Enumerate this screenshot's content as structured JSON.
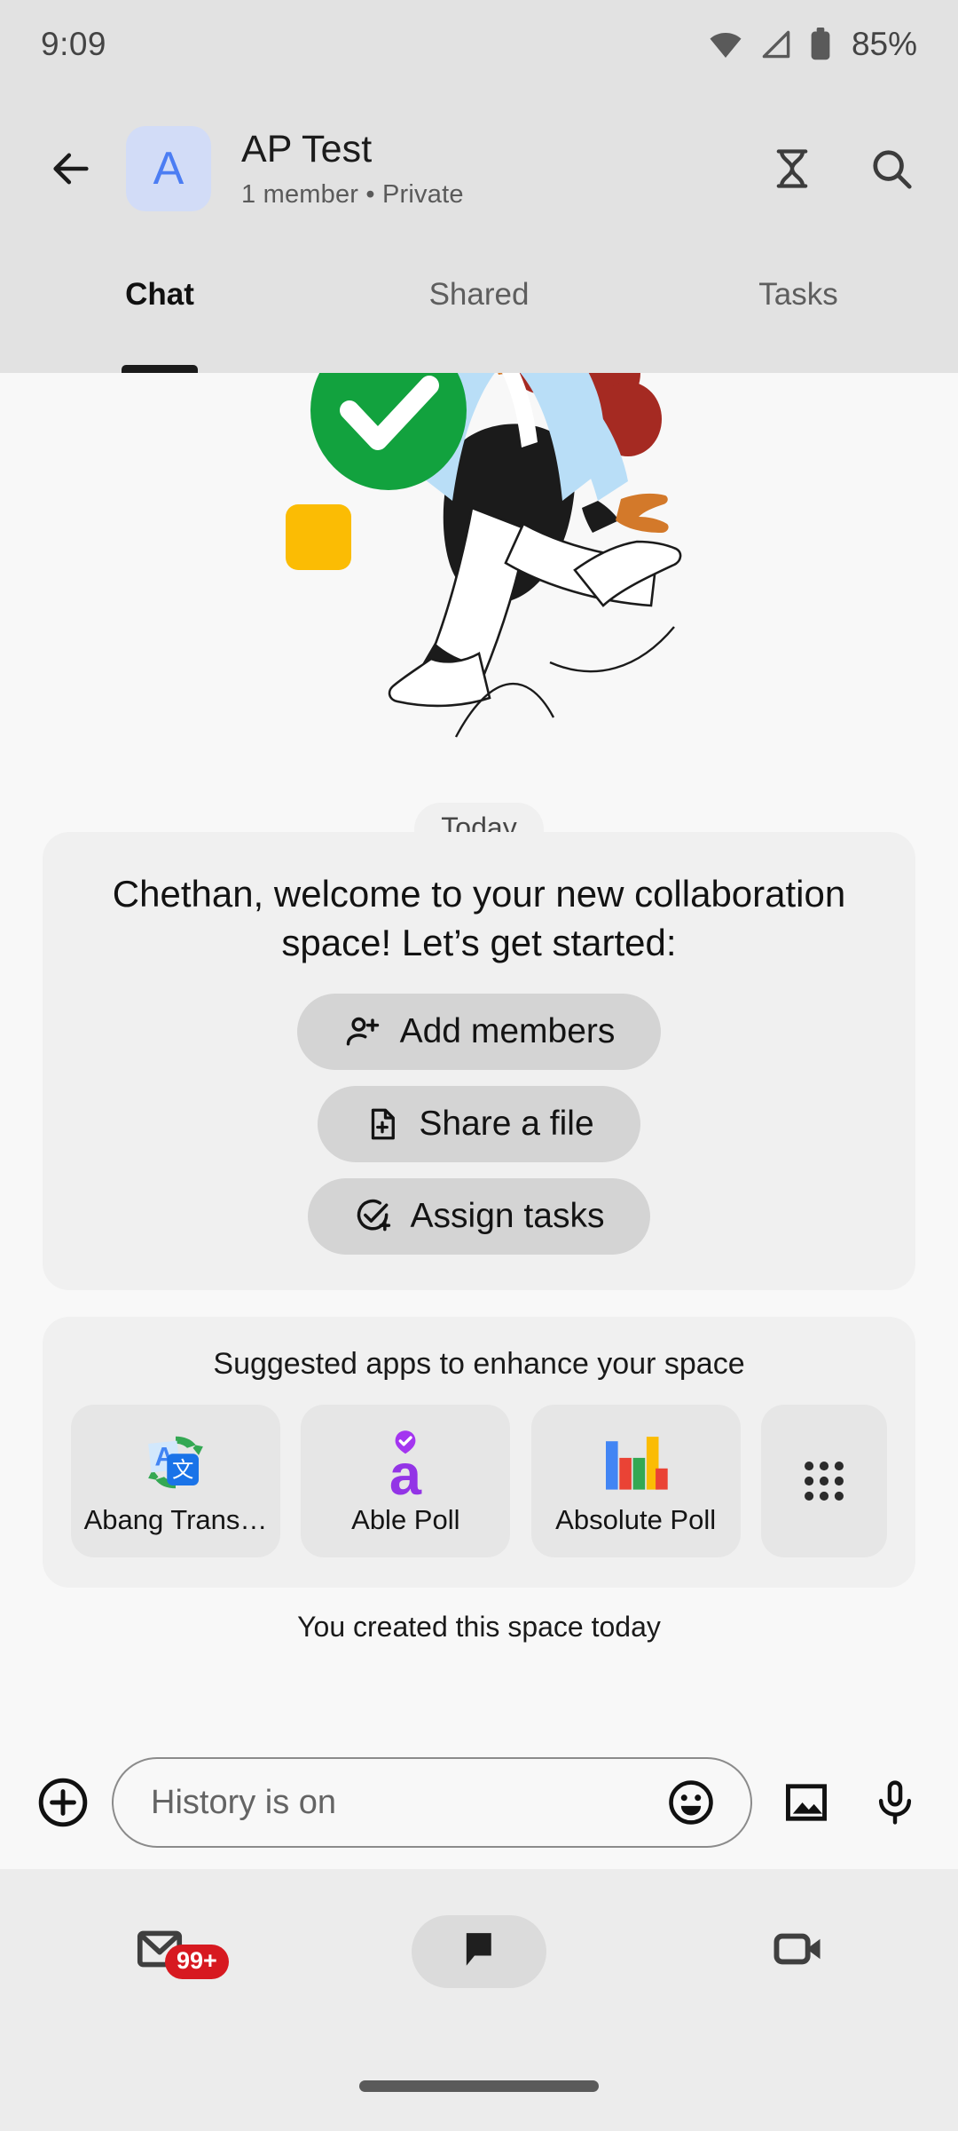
{
  "statusbar": {
    "time": "9:09",
    "battery": "85%",
    "icons": [
      "wifi-icon",
      "cell-signal-icon",
      "battery-icon"
    ]
  },
  "header": {
    "back_icon": "back-arrow-icon",
    "avatar_letter": "A",
    "avatar_bg": "#D2DCF7",
    "avatar_fg": "#4C7DF3",
    "title": "AP Test",
    "subtitle": "1 member  •  Private",
    "history_icon": "hourglass-icon",
    "search_icon": "search-icon"
  },
  "tabs": [
    {
      "label": "Chat",
      "active": true
    },
    {
      "label": "Shared",
      "active": false
    },
    {
      "label": "Tasks",
      "active": false
    }
  ],
  "illustration": {
    "name": "person-with-checkmark-illustration",
    "colors": {
      "check_circle": "#12A23E",
      "square": "#FBBC04",
      "balloon": "#A52A22",
      "shirt": "#B9DEF7",
      "skin": "#D3792A"
    }
  },
  "conversation": {
    "date_chip": "Today",
    "welcome_message": "Chethan, welcome to your new collaboration space! Let’s get started:",
    "quick_actions": [
      {
        "label": "Add members",
        "icon": "person-add-icon"
      },
      {
        "label": "Share a file",
        "icon": "file-add-icon"
      },
      {
        "label": "Assign tasks",
        "icon": "check-circle-add-icon"
      }
    ],
    "system_note": "You created this space today"
  },
  "suggested_apps": {
    "title": "Suggested apps to enhance your space",
    "items": [
      {
        "label": "Abang Trans…",
        "icon": "translate-app-icon"
      },
      {
        "label": "Able Poll",
        "icon": "able-poll-app-icon"
      },
      {
        "label": "Absolute Poll",
        "icon": "bar-chart-app-icon"
      }
    ],
    "more_icon": "apps-grid-icon"
  },
  "composer": {
    "add_icon": "plus-circle-icon",
    "placeholder": "History is on",
    "emoji_icon": "emoji-icon",
    "image_icon": "image-icon",
    "mic_icon": "microphone-icon"
  },
  "bottom_nav": [
    {
      "name": "mail",
      "icon": "mail-icon",
      "badge": "99+",
      "active": false
    },
    {
      "name": "chat",
      "icon": "chat-bubble-icon",
      "badge": "",
      "active": true
    },
    {
      "name": "meet",
      "icon": "video-camera-icon",
      "badge": "",
      "active": false
    }
  ]
}
